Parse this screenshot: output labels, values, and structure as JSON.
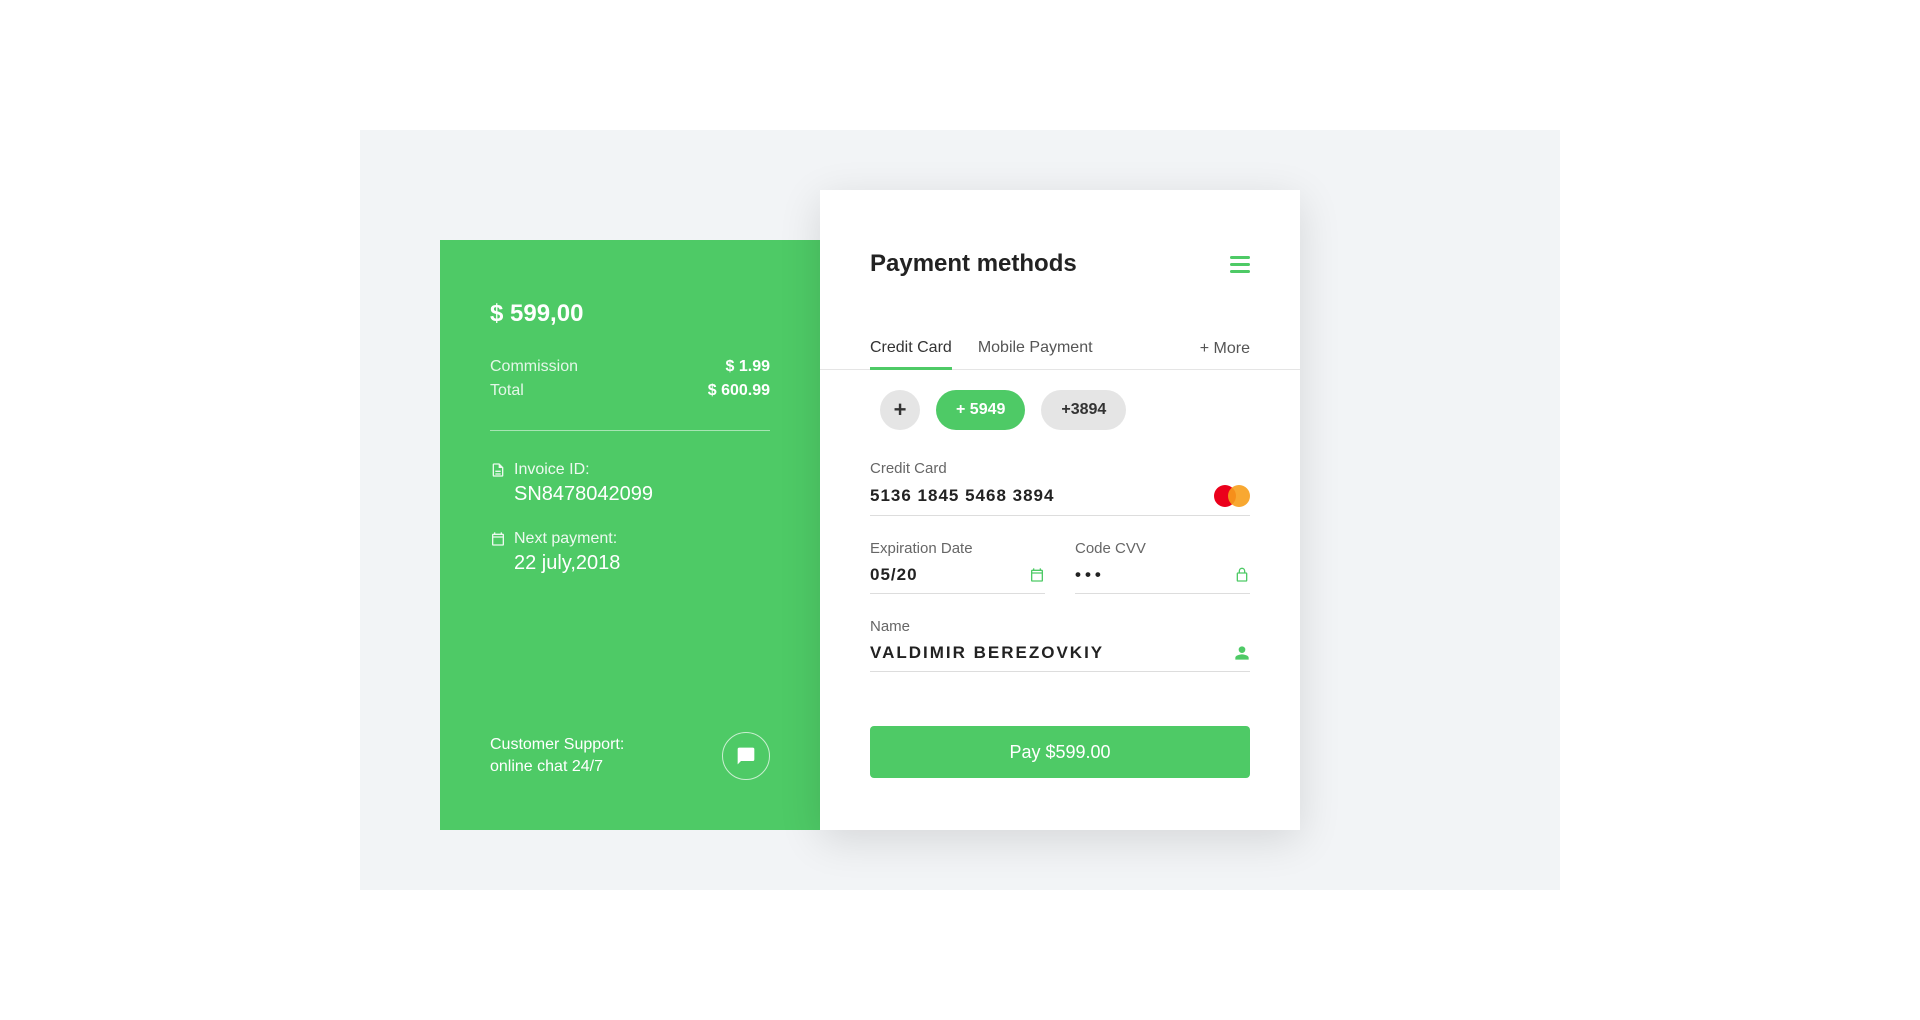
{
  "invoice": {
    "amount_display": "$ 599,00",
    "commission_label": "Commission",
    "commission_value": "$ 1.99",
    "total_label": "Total",
    "total_value": "$ 600.99",
    "invoice_id_label": "Invoice ID:",
    "invoice_id_value": "SN8478042099",
    "next_payment_label": "Next payment:",
    "next_payment_value": "22 july,2018",
    "support_line1": "Customer Support:",
    "support_line2": "online chat 24/7"
  },
  "payment": {
    "title": "Payment methods",
    "tabs": {
      "credit": "Credit Card",
      "mobile": "Mobile Payment",
      "more": "+ More"
    },
    "pills": {
      "add": "+",
      "p1": "+ 5949",
      "p2": "+3894"
    },
    "card_label": "Credit Card",
    "card_number": "5136 1845 5468 3894",
    "exp_label": "Expiration Date",
    "exp_value": "05/20",
    "cvv_label": "Code CVV",
    "cvv_value": "•••",
    "name_label": "Name",
    "name_value": "VALDIMIR BEREZOVKIY",
    "pay_button": "Pay $599.00"
  }
}
